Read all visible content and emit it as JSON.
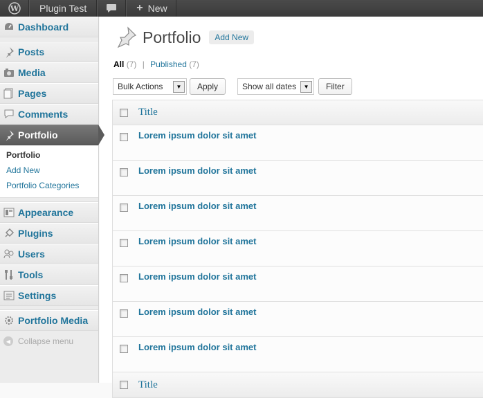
{
  "adminbar": {
    "site_name": "Plugin Test",
    "new_label": "New"
  },
  "sidebar": {
    "items": [
      {
        "label": "Dashboard",
        "icon": "dashboard-icon"
      },
      {
        "label": "Posts",
        "icon": "pin-icon"
      },
      {
        "label": "Media",
        "icon": "media-icon"
      },
      {
        "label": "Pages",
        "icon": "pages-icon"
      },
      {
        "label": "Comments",
        "icon": "comments-icon"
      },
      {
        "label": "Portfolio",
        "icon": "pin-icon"
      },
      {
        "label": "Appearance",
        "icon": "appearance-icon"
      },
      {
        "label": "Plugins",
        "icon": "plugins-icon"
      },
      {
        "label": "Users",
        "icon": "users-icon"
      },
      {
        "label": "Tools",
        "icon": "tools-icon"
      },
      {
        "label": "Settings",
        "icon": "settings-icon"
      },
      {
        "label": "Portfolio Media",
        "icon": "gear-icon"
      }
    ],
    "submenu": [
      "Portfolio",
      "Add New",
      "Portfolio Categories"
    ],
    "collapse_label": "Collapse menu"
  },
  "main": {
    "title": "Portfolio",
    "add_new": "Add New",
    "views": {
      "all_label": "All",
      "all_count": "(7)",
      "separator": "|",
      "published_label": "Published",
      "published_count": "(7)"
    },
    "bulk_actions": "Bulk Actions",
    "apply": "Apply",
    "dates": "Show all dates",
    "filter": "Filter",
    "column_title": "Title",
    "rows": [
      "Lorem ipsum dolor sit amet",
      "Lorem ipsum dolor sit amet",
      "Lorem ipsum dolor sit amet",
      "Lorem ipsum dolor sit amet",
      "Lorem ipsum dolor sit amet",
      "Lorem ipsum dolor sit amet",
      "Lorem ipsum dolor sit amet"
    ]
  },
  "colors": {
    "link": "#21759b",
    "adminbar": "#464646",
    "active_menu": "#5b5b5b"
  }
}
